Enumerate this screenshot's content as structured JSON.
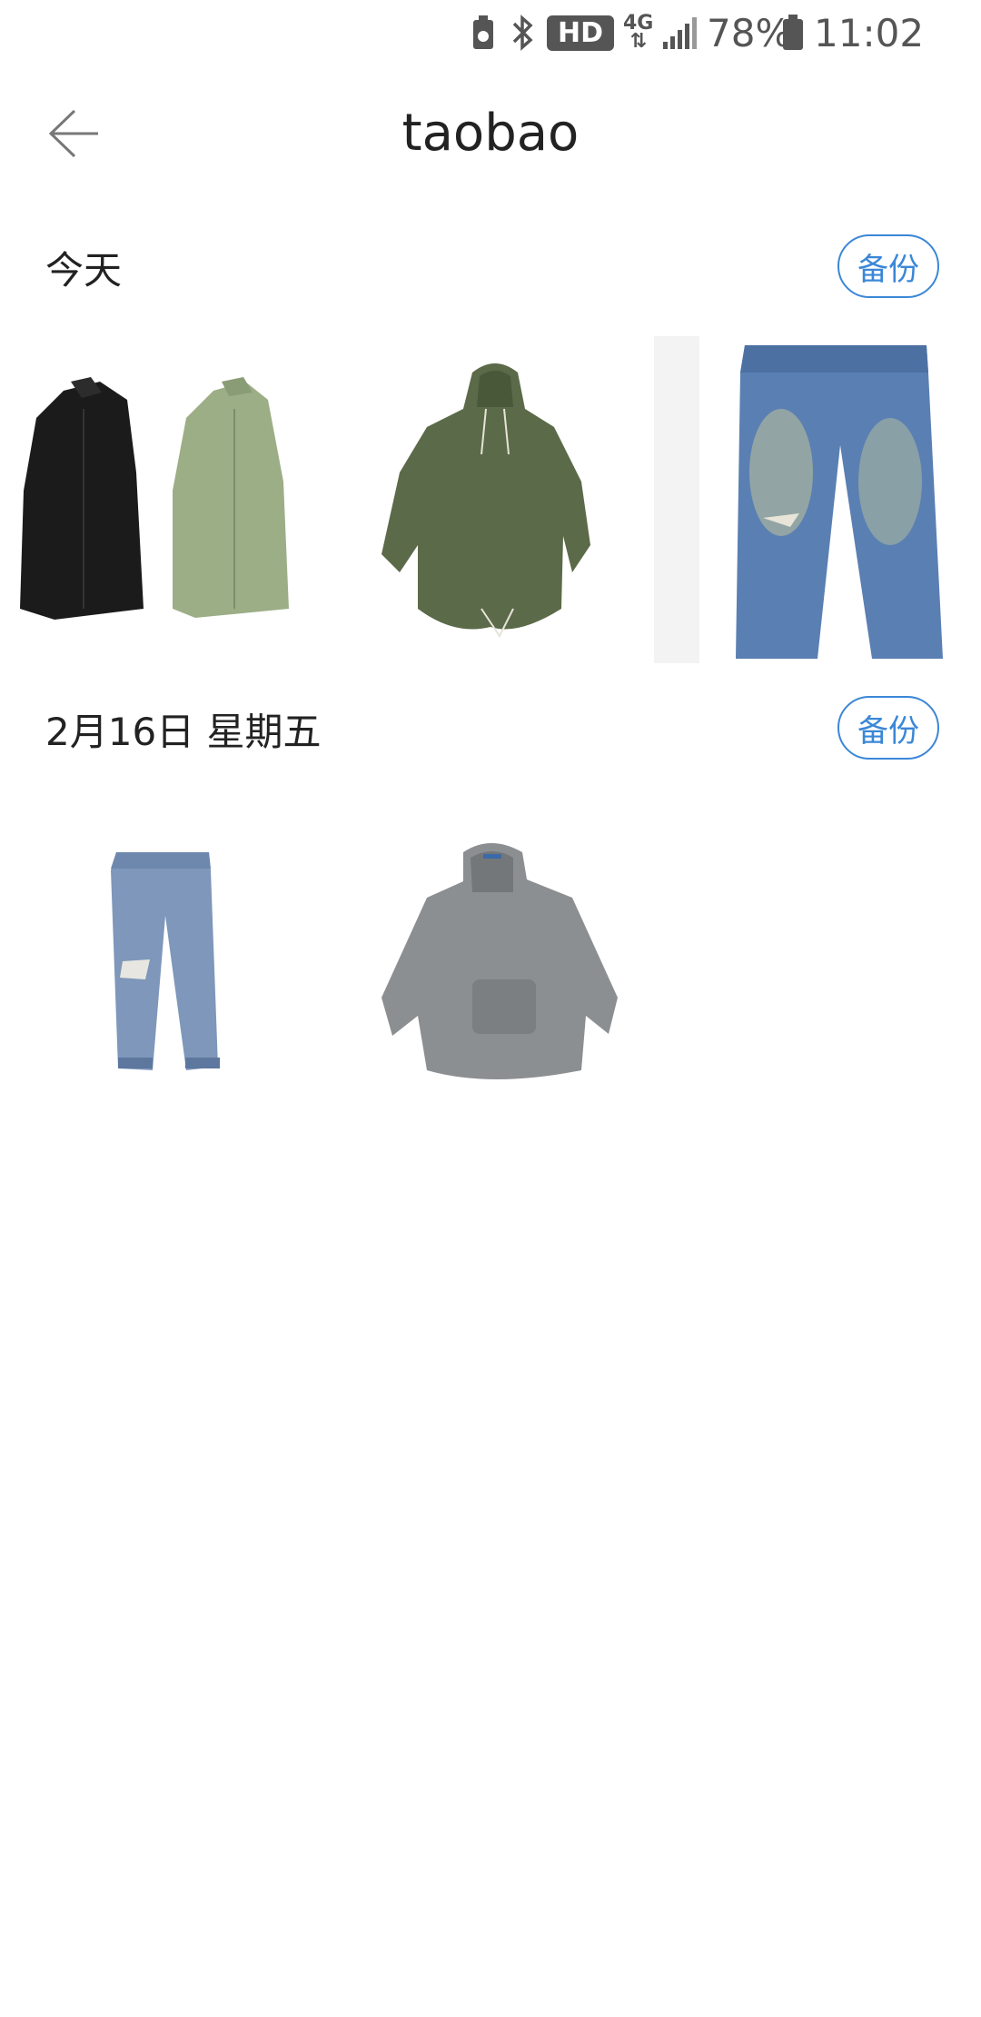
{
  "status_bar": {
    "hd_badge": "HD",
    "network": "4G",
    "battery_percent": "78%",
    "time": "11:02"
  },
  "header": {
    "title": "taobao"
  },
  "sections": [
    {
      "title": "今天",
      "backup_label": "备份",
      "items": [
        {
          "icon": "coats-black-green-image"
        },
        {
          "icon": "olive-parka-image"
        },
        {
          "icon": "faded-jeans-image"
        }
      ]
    },
    {
      "title": "2月16日 星期五",
      "backup_label": "备份",
      "items": [
        {
          "icon": "ripped-jeans-image"
        },
        {
          "icon": "grey-knit-hoodie-image"
        }
      ]
    }
  ],
  "colors": {
    "accent": "#3b87d7",
    "text": "#222222"
  }
}
